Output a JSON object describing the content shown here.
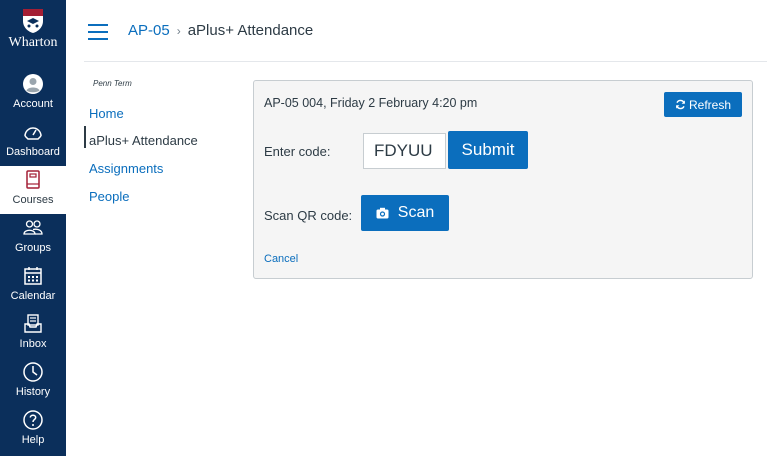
{
  "colors": {
    "nav_bg": "#0b2f5b",
    "link": "#0b6ebd",
    "button": "#0b6ebd",
    "text": "#2d3b45",
    "panel_bg": "#f5f5f5",
    "brand_red": "#a41f35"
  },
  "brand": {
    "name": "Wharton",
    "logo_icon": "penn-shield-icon"
  },
  "global_nav": {
    "items": [
      {
        "label": "Account",
        "icon": "account-avatar-icon"
      },
      {
        "label": "Dashboard",
        "icon": "dashboard-gauge-icon"
      },
      {
        "label": "Courses",
        "icon": "courses-book-icon",
        "active": true
      },
      {
        "label": "Groups",
        "icon": "groups-icon"
      },
      {
        "label": "Calendar",
        "icon": "calendar-icon"
      },
      {
        "label": "Inbox",
        "icon": "inbox-icon"
      },
      {
        "label": "History",
        "icon": "history-clock-icon"
      },
      {
        "label": "Help",
        "icon": "help-icon"
      }
    ]
  },
  "header": {
    "menu_icon": "hamburger-menu-icon",
    "breadcrumb": {
      "course": "AP-05",
      "separator": "›",
      "current": "aPlus+ Attendance"
    }
  },
  "course_nav": {
    "term": "Penn Term",
    "items": [
      {
        "label": "Home"
      },
      {
        "label": "aPlus+ Attendance",
        "active": true
      },
      {
        "label": "Assignments"
      },
      {
        "label": "People"
      }
    ]
  },
  "attendance": {
    "session_title": "AP-05 004, Friday 2 February 4:20 pm",
    "refresh_label": "Refresh",
    "refresh_icon": "refresh-icon",
    "enter_code_label": "Enter code:",
    "code_value": "FDYUU",
    "submit_label": "Submit",
    "scan_qr_label": "Scan QR code:",
    "scan_label": "Scan",
    "scan_icon": "camera-icon",
    "cancel_label": "Cancel"
  }
}
